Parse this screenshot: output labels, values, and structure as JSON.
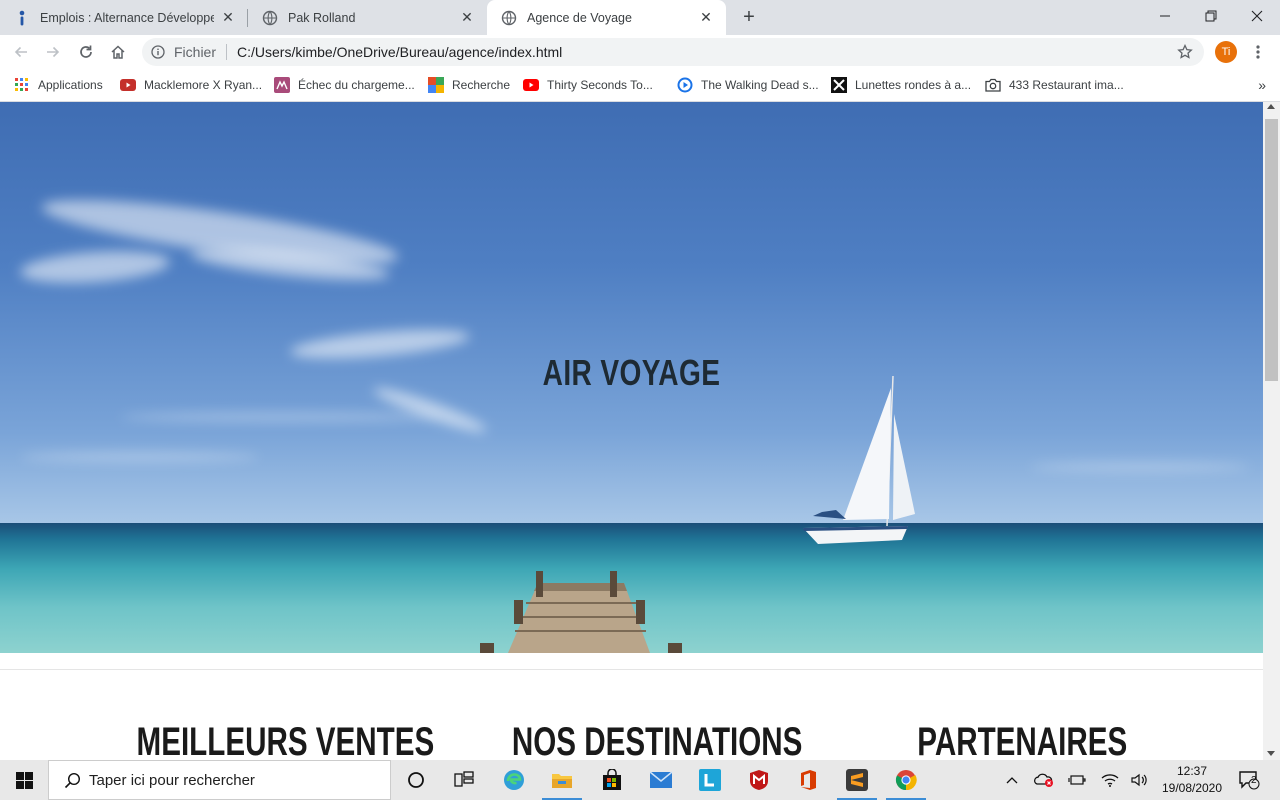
{
  "browser": {
    "tabs": [
      {
        "title": "Emplois : Alternance Développeur",
        "icon": "indeed-icon",
        "active": false
      },
      {
        "title": "Pak Rolland",
        "icon": "globe-icon",
        "active": false
      },
      {
        "title": "Agence de Voyage",
        "icon": "globe-icon",
        "active": true
      }
    ],
    "new_tab_label": "+",
    "scheme_label": "Fichier",
    "url": "C:/Users/kimbe/OneDrive/Bureau/agence/index.html",
    "profile_initials": "Ti",
    "profile_color": "#e8710a"
  },
  "bookmarks": [
    {
      "label": "Applications",
      "icon": "apps-grid-icon"
    },
    {
      "label": "Macklemore X Ryan...",
      "icon": "youtube-icon"
    },
    {
      "label": "Échec du chargeme...",
      "icon": "pink-site-icon"
    },
    {
      "label": "Recherche",
      "icon": "colorful-site-icon"
    },
    {
      "label": "Thirty Seconds To...",
      "icon": "youtube-icon"
    },
    {
      "label": "The Walking Dead s...",
      "icon": "play-circle-icon"
    },
    {
      "label": "Lunettes rondes à a...",
      "icon": "x-logo-icon"
    },
    {
      "label": "433 Restaurant ima...",
      "icon": "camera-icon"
    }
  ],
  "page": {
    "hero_title": "AIR VOYAGE",
    "sections": [
      "MEILLEURS VENTES",
      "NOS DESTINATIONS",
      "PARTENAIRES"
    ]
  },
  "taskbar": {
    "search_placeholder": "Taper ici pour rechercher",
    "time": "12:37",
    "date": "19/08/2020",
    "notification_count": "2"
  }
}
